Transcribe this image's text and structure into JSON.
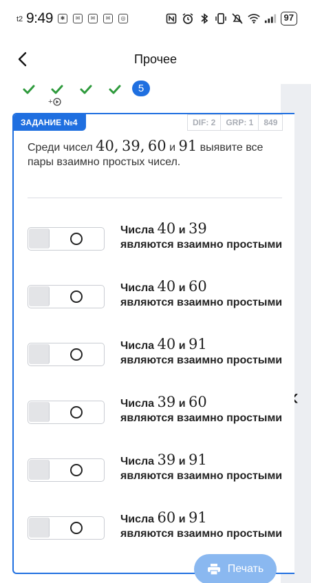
{
  "status_bar": {
    "carrier": "t2",
    "time": "9:49",
    "battery": "97",
    "notification_icons": [
      "app-icon",
      "app-icon",
      "app-icon",
      "app-icon",
      "app-icon"
    ]
  },
  "header": {
    "title": "Прочее"
  },
  "progress": {
    "completed_count": 4,
    "sub_label": "+",
    "current": "5",
    "check_color": "#2e9a3c"
  },
  "task": {
    "badge": "ЗАДАНИЕ №4",
    "tags": [
      "DIF: 2",
      "GRP: 1",
      "849"
    ],
    "question": {
      "prefix": "Среди чисел",
      "n1": "40,",
      "n2": "39,",
      "n3": "60",
      "and": "и",
      "n4": "91",
      "suffix": "выявите все пары взаимно простых чисел."
    },
    "options": [
      {
        "word": "Числа",
        "a": "40",
        "and": "и",
        "b": "39",
        "rest": "являются взаимно простыми",
        "checked": false
      },
      {
        "word": "Числа",
        "a": "40",
        "and": "и",
        "b": "60",
        "rest": "являются взаимно простыми",
        "checked": false
      },
      {
        "word": "Числа",
        "a": "40",
        "and": "и",
        "b": "91",
        "rest": "являются взаимно простыми",
        "checked": false
      },
      {
        "word": "Числа",
        "a": "39",
        "and": "и",
        "b": "60",
        "rest": "являются взаимно простыми",
        "checked": false
      },
      {
        "word": "Числа",
        "a": "39",
        "and": "и",
        "b": "91",
        "rest": "являются взаимно простыми",
        "checked": false
      },
      {
        "word": "Числа",
        "a": "60",
        "and": "и",
        "b": "91",
        "rest": "являются взаимно простыми",
        "checked": false
      }
    ]
  },
  "print_button": {
    "label": "Печать"
  },
  "colors": {
    "accent": "#1f6fe0",
    "print_bg": "#8ab8f0",
    "panel": "#eceef2"
  }
}
